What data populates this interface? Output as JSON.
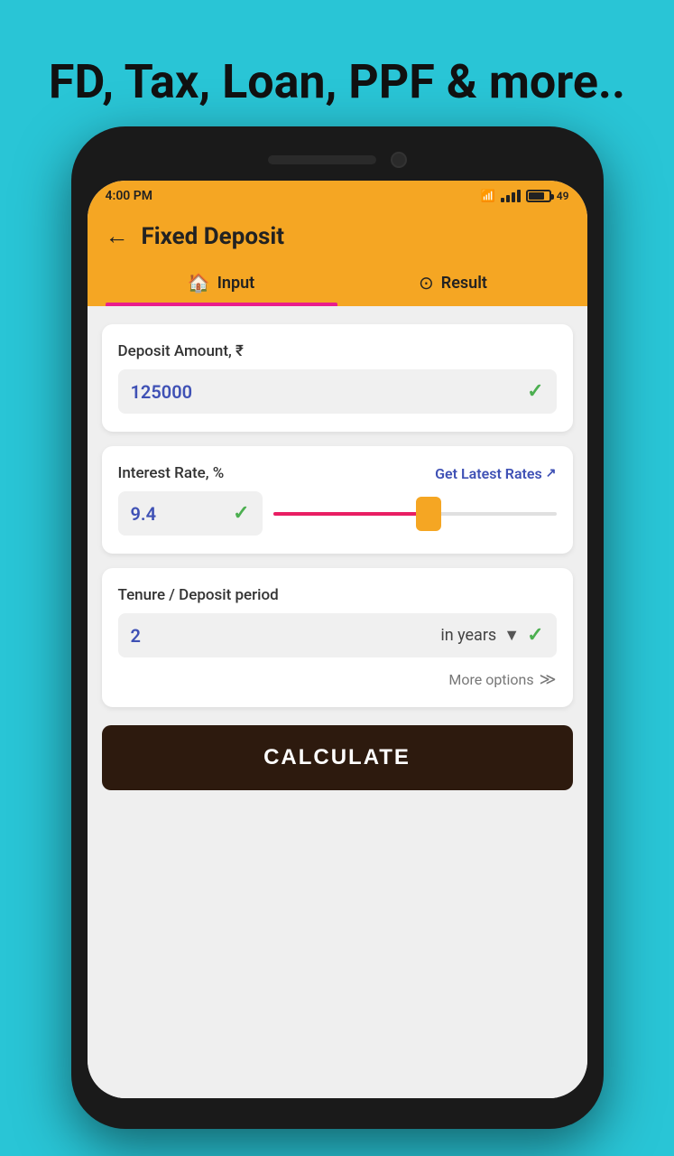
{
  "page": {
    "bg_title": "FD, Tax, Loan, PPF & more..",
    "status": {
      "time": "4:00 PM",
      "battery_level": "49"
    },
    "header": {
      "back_label": "←",
      "title": "Fixed Deposit"
    },
    "tabs": [
      {
        "id": "input",
        "icon": "🏠",
        "label": "Input",
        "active": true
      },
      {
        "id": "result",
        "icon": "⊙",
        "label": "Result",
        "active": false
      }
    ],
    "fields": {
      "deposit": {
        "label": "Deposit Amount, ₹",
        "value": "125000"
      },
      "interest": {
        "label": "Interest Rate, %",
        "value": "9.4",
        "get_rates_label": "Get Latest Rates",
        "slider_percent": 55
      },
      "tenure": {
        "label": "Tenure / Deposit period",
        "value": "2",
        "unit": "in years"
      }
    },
    "more_options_label": "More options",
    "calculate_label": "CALCULATE"
  }
}
